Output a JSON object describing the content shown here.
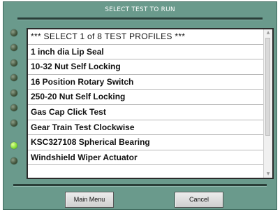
{
  "dialog": {
    "title": "SELECT TEST TO RUN"
  },
  "list": {
    "header": "*** SELECT 1 of 8 TEST PROFILES ***",
    "items": [
      "1 inch dia Lip Seal",
      "10-32 Nut Self Locking",
      "16 Position Rotary Switch",
      "250-20 Nut Self Locking",
      "Gas Cap Click Test",
      "Gear Train Test Clockwise",
      "KSC327108 Spherical Bearing",
      "Windshield Wiper Actuator"
    ],
    "indicators": [
      "off",
      "off",
      "off",
      "off",
      "off",
      "off",
      "off",
      "on",
      "off"
    ]
  },
  "buttons": {
    "main_menu": "Main Menu",
    "cancel": "Cancel"
  },
  "colors": {
    "panel": "#6a9a8c",
    "led_on": "#86e03a",
    "led_off": "#45573f"
  }
}
